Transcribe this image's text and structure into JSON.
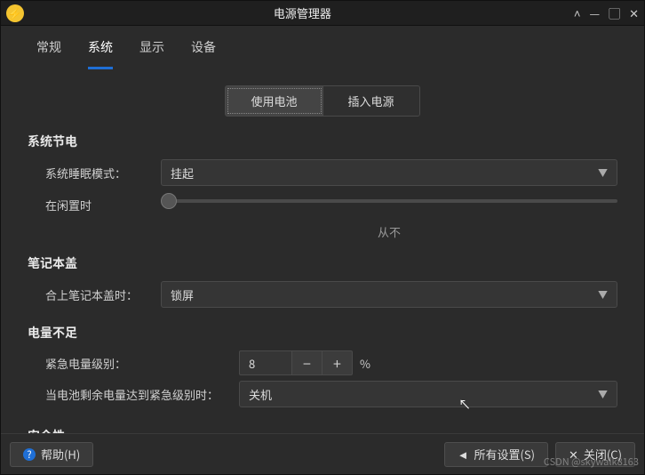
{
  "window": {
    "title": "电源管理器"
  },
  "tabs": [
    {
      "label": "常规",
      "active": false
    },
    {
      "label": "系统",
      "active": true
    },
    {
      "label": "显示",
      "active": false
    },
    {
      "label": "设备",
      "active": false
    }
  ],
  "power_source_toggle": {
    "battery_label": "使用电池",
    "plugged_label": "插入电源",
    "active": "battery"
  },
  "sections": {
    "power_saving": {
      "heading": "系统节电",
      "sleep_mode_label": "系统睡眠模式：",
      "sleep_mode_value": "挂起",
      "idle_label": "在闲置时",
      "idle_slider_text": "从不"
    },
    "lid": {
      "heading": "笔记本盖",
      "close_lid_label": "合上笔记本盖时：",
      "close_lid_value": "锁屏"
    },
    "low_power": {
      "heading": "电量不足",
      "critical_level_label": "紧急电量级别：",
      "critical_level_value": "8",
      "critical_level_unit": "%",
      "critical_action_label": "当电池剩余电量达到紧急级别时：",
      "critical_action_value": "关机"
    },
    "security": {
      "heading": "安全性"
    }
  },
  "footer": {
    "help_label": "帮助(H)",
    "all_settings_label": "所有设置(S)",
    "close_label": "关闭(C)"
  },
  "watermark": "CSDN @skywalk8163"
}
